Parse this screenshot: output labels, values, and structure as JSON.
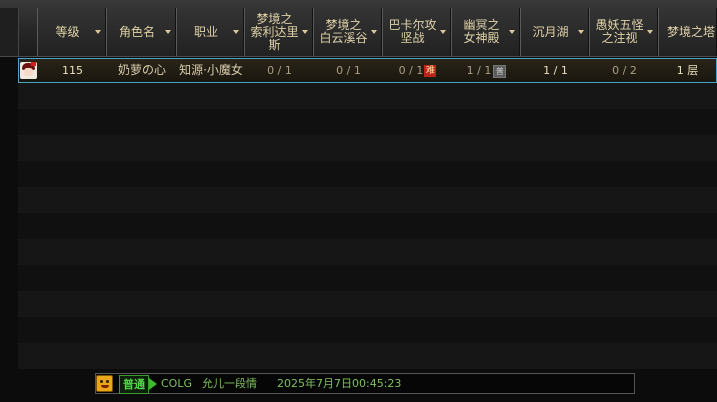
{
  "header": {
    "columns": [
      {
        "label": "等级"
      },
      {
        "label": "角色名"
      },
      {
        "label": "职业"
      },
      {
        "label": "梦境之\n索利达里\n斯"
      },
      {
        "label": "梦境之\n白云溪谷"
      },
      {
        "label": "巴卡尔攻\n坚战"
      },
      {
        "label": "幽冥之\n女神殿"
      },
      {
        "label": "沉月湖"
      },
      {
        "label": "愚妖五怪\n之注视"
      },
      {
        "label": "梦境之塔"
      }
    ]
  },
  "row": {
    "level": "115",
    "name": "奶萝の心",
    "job": "知源·小魔女",
    "col4": "0 / 1",
    "col5": "0 / 1",
    "col6": "0 / 1",
    "col6_badge": "难",
    "col7": "1 / 1",
    "col7_badge": "普",
    "col8": "1 / 1",
    "col9": "0 / 2",
    "col10": "1 层"
  },
  "chat": {
    "channel": "普通",
    "sender": "COLG",
    "message": "允儿一段情",
    "timestamp": "2025年7月7日00:45:23"
  },
  "colors": {
    "header_text": "#e0d3a8",
    "row_highlight_border": "#4aa3c8",
    "hard_badge": "#b8261b",
    "chat_green": "#55d84a"
  }
}
